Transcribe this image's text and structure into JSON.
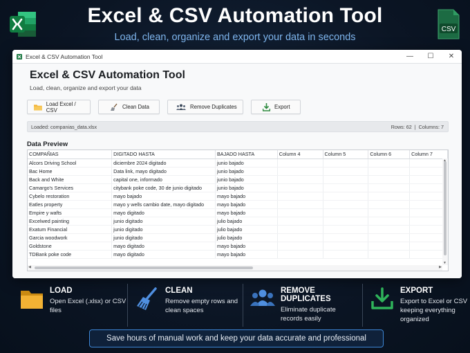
{
  "hero": {
    "title": "Excel & CSV Automation Tool",
    "subtitle": "Load, clean, organize and export your data in seconds",
    "excel_icon": "excel-icon",
    "csv_icon": "csv-file-icon",
    "csv_label": "CSV"
  },
  "window": {
    "title": "Excel & CSV Automation Tool",
    "controls": {
      "minimize": "—",
      "maximize": "☐",
      "close": "✕"
    }
  },
  "app": {
    "heading": "Excel & CSV Automation Tool",
    "subheading": "Load, clean, organize and export your data",
    "toolbar": {
      "load": "Load Excel / CSV",
      "clean": "Clean Data",
      "remove_duplicates": "Remove Duplicates",
      "export": "Export"
    },
    "status": {
      "loaded": "Loaded: companias_data.xlsx",
      "rows": "Rows: 62",
      "separator": "|",
      "columns": "Columns: 7"
    },
    "preview_title": "Data Preview",
    "table": {
      "columns": [
        "COMPAÑIAS",
        "DIGITADO HASTA",
        "BAJADO HASTA",
        "Column 4",
        "Column 5",
        "Column 6",
        "Column 7"
      ],
      "rows": [
        [
          "Alcors Driving School",
          "diciembre 2024 digitado",
          "junio bajado",
          "",
          "",
          "",
          ""
        ],
        [
          "Bac Home",
          "Data link, mayo digitado",
          "junio bajado",
          "",
          "",
          "",
          ""
        ],
        [
          "Back and White",
          "capital one, informado",
          "junio bajado",
          "",
          "",
          "",
          ""
        ],
        [
          "Camargo's Services",
          "citybank poke code, 30 de junio digitado",
          "junio bajado",
          "",
          "",
          "",
          ""
        ],
        [
          "Cybelo restoration",
          "mayo bajado",
          "mayo bajado",
          "",
          "",
          "",
          ""
        ],
        [
          "Eatles property",
          "mayo y wells cambio date, mayo digitado",
          "mayo bajado",
          "",
          "",
          "",
          ""
        ],
        [
          "Empire y wafts",
          "mayo digitado",
          "mayo bajado",
          "",
          "",
          "",
          ""
        ],
        [
          "Excelwed painting",
          "junio digitado",
          "julio bajado",
          "",
          "",
          "",
          ""
        ],
        [
          "Exatum Financial",
          "junio digitado",
          "julio bajado",
          "",
          "",
          "",
          ""
        ],
        [
          "Garcia woodwork",
          "junio digitado",
          "julio bajado",
          "",
          "",
          "",
          ""
        ],
        [
          "Goldstone",
          "mayo digitado",
          "mayo bajado",
          "",
          "",
          "",
          ""
        ],
        [
          "TDBank poke code",
          "mayo digitado",
          "mayo bajado",
          "",
          "",
          "",
          ""
        ]
      ]
    }
  },
  "features": [
    {
      "title": "LOAD",
      "desc": "Open Excel (.xlsx) or CSV files",
      "icon": "folder-icon"
    },
    {
      "title": "CLEAN",
      "desc": "Remove empty rows and clean spaces",
      "icon": "broom-icon"
    },
    {
      "title": "REMOVE DUPLICATES",
      "desc": "Eliminate duplicate records easily",
      "icon": "users-icon"
    },
    {
      "title": "EXPORT",
      "desc": "Export to Excel or CSV keeping everything organized",
      "icon": "download-icon"
    }
  ],
  "footer": "Save hours of manual work and keep your data accurate and professional",
  "colors": {
    "background": "#0b1524",
    "accent": "#7fb6ee",
    "excel_green": "#1f7a45",
    "csv_green": "#1c6b43",
    "folder_yellow": "#f2b234",
    "export_green": "#2c8a3e",
    "feature_blue": "#4f8fe0"
  }
}
